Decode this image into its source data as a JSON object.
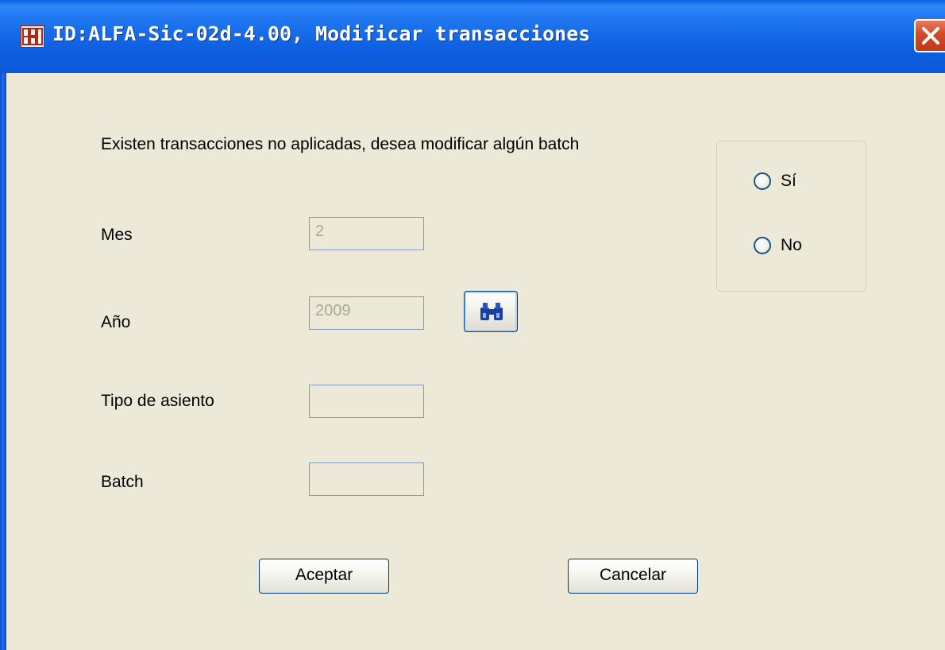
{
  "window": {
    "title": "ID:ALFA-Sic-02d-4.00, Modificar transacciones",
    "icon": "app-logo-icon",
    "close_icon": "close-icon"
  },
  "form": {
    "prompt": "Existen transacciones no aplicadas, desea modificar algún batch",
    "fields": {
      "mes": {
        "label": "Mes",
        "value": "2"
      },
      "anio": {
        "label": "Año",
        "value": "2009"
      },
      "tipo": {
        "label": "Tipo de asiento",
        "value": ""
      },
      "batch": {
        "label": "Batch",
        "value": ""
      }
    },
    "search_icon": "binoculars-icon",
    "options": {
      "si": "Sí",
      "no": "No"
    }
  },
  "buttons": {
    "accept": "Aceptar",
    "cancel": "Cancelar"
  },
  "colors": {
    "titlebar": "#0b58d6",
    "dialog_bg": "#ece9d8",
    "close_button": "#c1391a",
    "disabled_text": "#aca899"
  }
}
